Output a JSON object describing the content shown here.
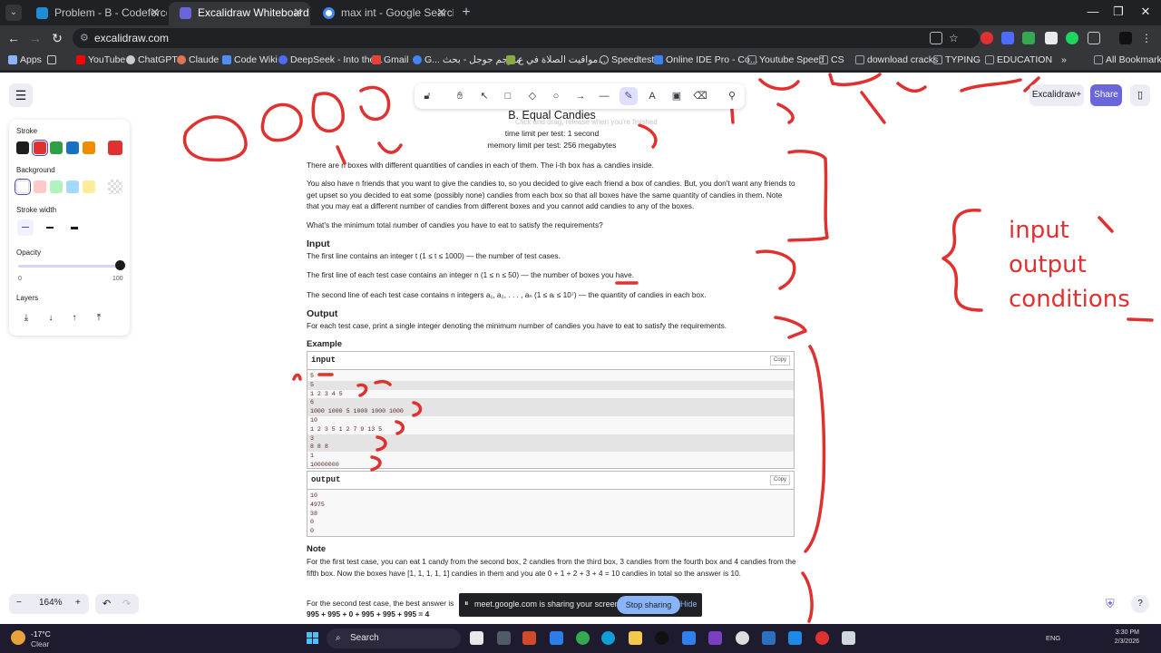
{
  "browser": {
    "tabs": [
      {
        "title": "Problem - B - Codeforces",
        "favicon_color": "#1f8dd6"
      },
      {
        "title": "Excalidraw Whiteboard",
        "favicon_color": "#6965db"
      },
      {
        "title": "max int - Google Search",
        "favicon_color": "#4285f4"
      }
    ],
    "url": "excalidraw.com",
    "bookmarks": [
      {
        "label": "Apps",
        "color": "#8ab4f8"
      },
      {
        "label": "YouTube",
        "color": "#ff0000"
      },
      {
        "label": "ChatGPT",
        "color": "#cccccc"
      },
      {
        "label": "Claude",
        "color": "#d97757"
      },
      {
        "label": "Code Wiki",
        "color": "#4f8df5"
      },
      {
        "label": "DeepSeek - Into the...",
        "color": "#4d6bfe"
      },
      {
        "label": "Gmail",
        "color": "#ea4335"
      },
      {
        "label": "G... مترجم جوجل - بحث",
        "color": "#4285f4"
      },
      {
        "label": "مواقيت الصلاة في ع...",
        "color": "#88aa44"
      },
      {
        "label": "Speedtest",
        "color": "#cccccc"
      },
      {
        "label": "Online IDE Pro - Co...",
        "color": "#3b82f6"
      },
      {
        "label": "Youtube Speed",
        "color": "#9aa0a6"
      },
      {
        "label": "CS",
        "color": "#9aa0a6"
      },
      {
        "label": "download cracks",
        "color": "#9aa0a6"
      },
      {
        "label": "TYPING",
        "color": "#9aa0a6"
      },
      {
        "label": "EDUCATION",
        "color": "#9aa0a6"
      }
    ],
    "all_bookmarks": "All Bookmarks"
  },
  "excalidraw": {
    "toolbar_hint": "Click and drag, release when you're finished",
    "library_label": "Excalidraw+",
    "share_label": "Share",
    "stroke_label": "Stroke",
    "stroke_colors": [
      "#1e1e1e",
      "#e03131",
      "#2f9e44",
      "#1971c2",
      "#f08c00"
    ],
    "stroke_selected": "#e03131",
    "background_label": "Background",
    "background_colors": [
      "#ffffff",
      "#ffc9c9",
      "#b2f2bb",
      "#a5d8ff",
      "#ffec99"
    ],
    "stroke_width_label": "Stroke width",
    "opacity_label": "Opacity",
    "opacity_min": "0",
    "opacity_max": "100",
    "opacity_value": 100,
    "layers_label": "Layers",
    "zoom": "164%",
    "zoom_minus": "−",
    "zoom_plus": "+"
  },
  "problem": {
    "title": "B. Equal Candies",
    "time_limit": "time limit per test: 1 second",
    "memory_limit": "memory limit per test: 256 megabytes",
    "statement_1": "There are n boxes with different quantities of candies in each of them. The i-th box has aᵢ candies inside.",
    "statement_2": "You also have n friends that you want to give the candies to, so you decided to give each friend a box of candies. But, you don't want any friends to get upset so you decided to eat some (possibly none) candies from each box so that all boxes have the same quantity of candies in them. Note that you may eat a different number of candies from different boxes and you cannot add candies to any of the boxes.",
    "statement_3": "What's the minimum total number of candies you have to eat to satisfy the requirements?",
    "input_heading": "Input",
    "input_1": "The first line contains an integer t (1 ≤ t ≤ 1000) — the number of test cases.",
    "input_2": "The first line of each test case contains an integer n (1 ≤ n ≤ 50) — the number of boxes you have.",
    "input_3": "The second line of each test case contains n integers a₁, a₂, . . . , aₙ (1 ≤ aᵢ ≤ 10⁷) — the quantity of candies in each box.",
    "output_heading": "Output",
    "output_1": "For each test case, print a single integer denoting the minimum number of candies you have to eat to satisfy the requirements.",
    "example_heading": "Example",
    "example_input_label": "input",
    "example_output_label": "output",
    "copy_label": "Copy",
    "example_input_lines": [
      "5",
      "5",
      "1 2 3 4 5",
      "6",
      "1000 1000 5 1000 1000 1000",
      "10",
      "1 2 3 5 1 2 7 9 13 5",
      "3",
      "8 8 8",
      "1",
      "10000000"
    ],
    "example_output_lines": [
      "10",
      "4975",
      "38",
      "0",
      "0"
    ],
    "note_heading": "Note",
    "note_1": "For the first test case, you can eat 1 candy from the second box, 2 candies from the third box, 3 candies from the fourth box and 4 candies from the fifth box. Now the boxes have [1, 1, 1, 1, 1] candies in them and you ate 0 + 1 + 2 + 3 + 4 = 10 candies in total so the answer is 10.",
    "note_2_start": "For the second test case, the best answer is",
    "note_2_eq": "995 + 995 + 0 + 995 + 995 + 995 = 4"
  },
  "annotations": {
    "line_1": "input",
    "line_2": "output",
    "line_3": "conditions"
  },
  "sharing_bar": {
    "message": "meet.google.com is sharing your screen.",
    "stop_label": "Stop sharing",
    "hide_label": "Hide"
  },
  "taskbar": {
    "temperature": "-17°C",
    "weather": "Clear",
    "search_label": "Search",
    "language": "ENG",
    "time": "3:30 PM",
    "date": "2/3/2026"
  },
  "ink_color": "#e03131"
}
